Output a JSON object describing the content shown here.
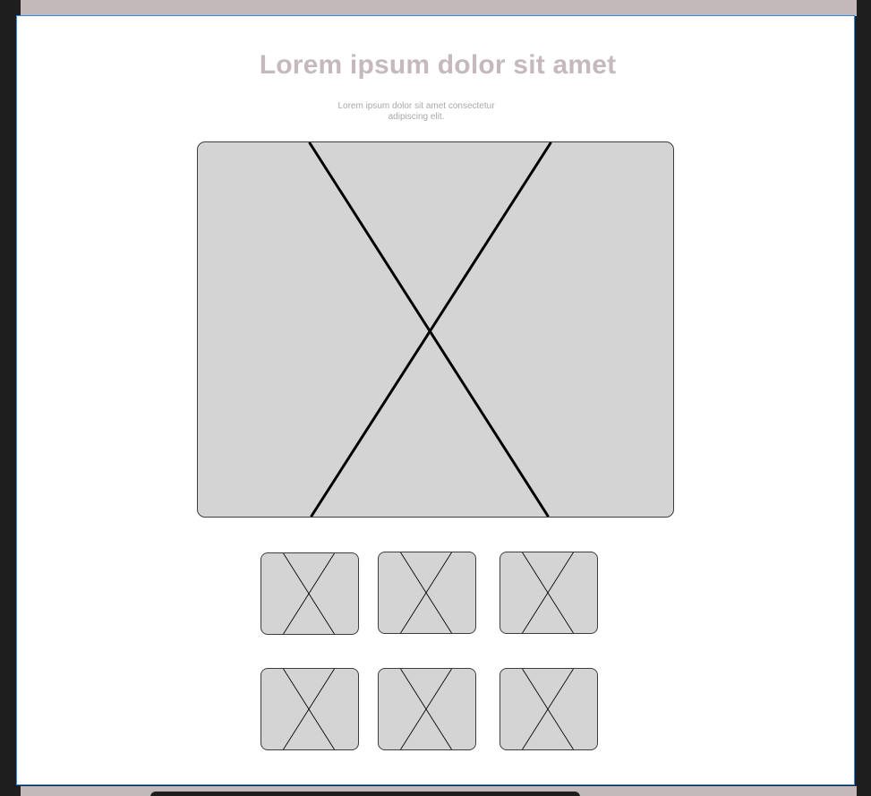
{
  "page": {
    "title": "Lorem ipsum dolor sit amet",
    "subtitle": "Lorem ipsum dolor sit amet consectetur adipiscing elit."
  },
  "colors": {
    "frame_border": "#2c8be0",
    "placeholder_fill": "#d4d4d4",
    "title_color": "#c6b9bc",
    "subtitle_color": "#a9a9ab",
    "top_strip": "#c4b9ba"
  },
  "gallery": {
    "hero": {
      "icon": "image-placeholder-icon"
    },
    "thumbnails": [
      {
        "icon": "image-placeholder-icon"
      },
      {
        "icon": "image-placeholder-icon"
      },
      {
        "icon": "image-placeholder-icon"
      },
      {
        "icon": "image-placeholder-icon"
      },
      {
        "icon": "image-placeholder-icon"
      },
      {
        "icon": "image-placeholder-icon"
      }
    ]
  }
}
